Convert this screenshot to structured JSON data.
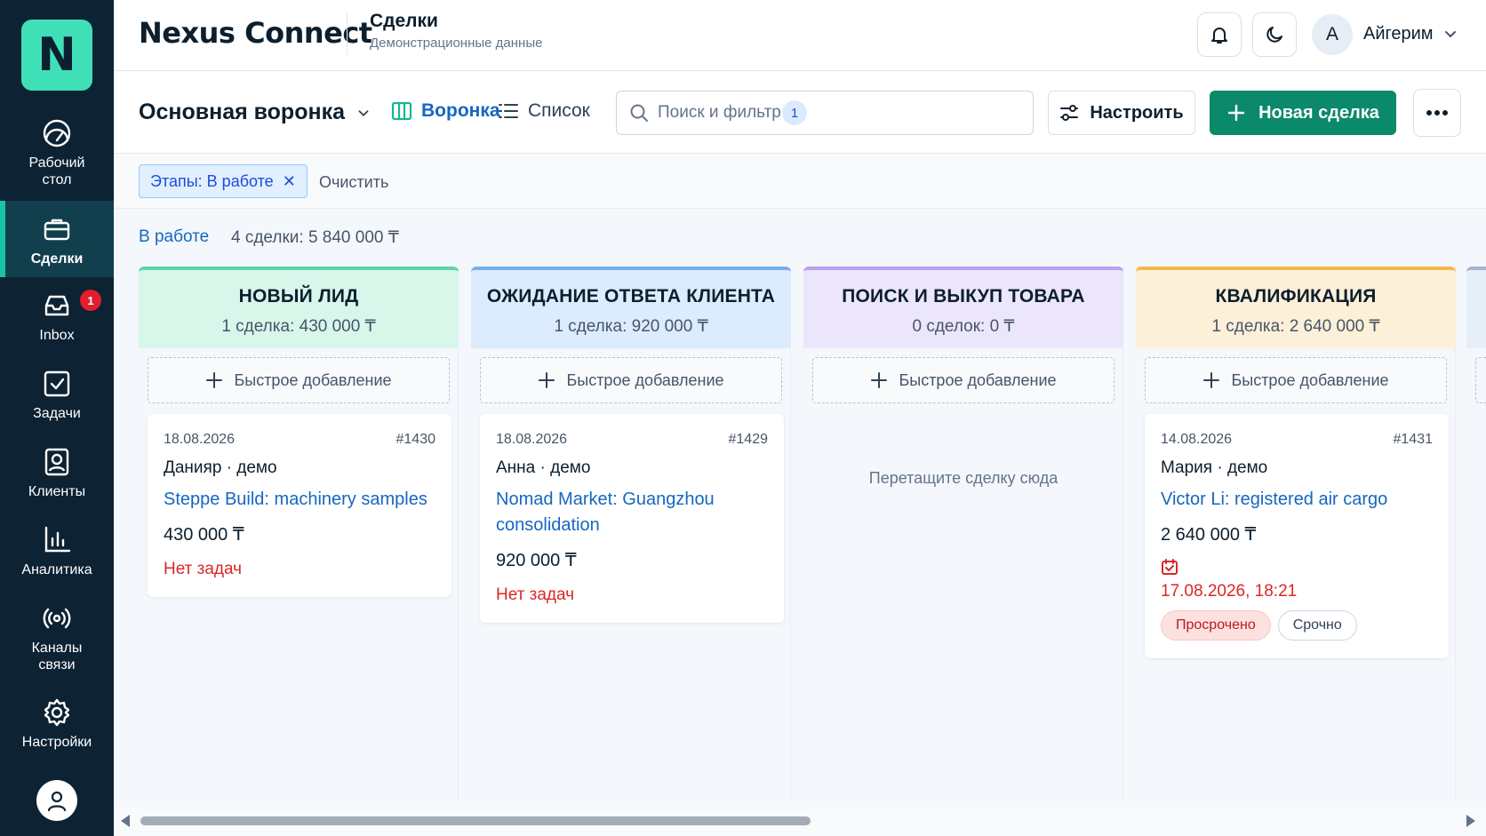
{
  "app": {
    "logo_letter": "N",
    "name": "Nexus Connect"
  },
  "sidebar": {
    "items": [
      {
        "label": "Рабочий стол",
        "icon": "dashboard-icon"
      },
      {
        "label": "Сделки",
        "icon": "briefcase-icon",
        "active": true
      },
      {
        "label": "Inbox",
        "icon": "inbox-icon",
        "badge": "1"
      },
      {
        "label": "Задачи",
        "icon": "task-check-icon"
      },
      {
        "label": "Клиенты",
        "icon": "contact-card-icon"
      },
      {
        "label": "Аналитика",
        "icon": "bar-chart-icon"
      },
      {
        "label": "Каналы связи",
        "icon": "broadcast-icon"
      },
      {
        "label": "Настройки",
        "icon": "gear-icon"
      }
    ],
    "profile_icon": "user-icon"
  },
  "header": {
    "title": "Сделки",
    "subtitle": "Демонстрационные данные",
    "user_initial": "А",
    "user_name": "Айгерим"
  },
  "toolbar": {
    "pipeline": "Основная воронка",
    "view_funnel": "Воронка",
    "view_list": "Список",
    "search_placeholder": "Поиск и фильтр",
    "filter_count": "1",
    "configure_label": "Настроить",
    "new_deal_label": "Новая сделка"
  },
  "filters": {
    "chip": "Этапы: В работе",
    "clear": "Очистить"
  },
  "summary": {
    "stage": "В работе",
    "total": "4 сделки: 5 840 000 ₸"
  },
  "quick_add_label": "Быстрое добавление",
  "columns": [
    {
      "title": "НОВЫЙ ЛИД",
      "subtitle": "1 сделка: 430 000 ₸",
      "color": "#5fd4a6",
      "bg": "#d8f6ea",
      "cards": [
        {
          "date": "18.08.2026",
          "id": "#1430",
          "person": "Данияр · демо",
          "title": "Steppe Build: machinery samples",
          "amount": "430 000 ₸",
          "tasks": "Нет задач"
        }
      ]
    },
    {
      "title": "ОЖИДАНИЕ ОТВЕТА КЛИЕНТА",
      "subtitle": "1 сделка: 920 000 ₸",
      "color": "#78aef0",
      "bg": "#dcebfd",
      "cards": [
        {
          "date": "18.08.2026",
          "id": "#1429",
          "person": "Анна · демо",
          "title": "Nomad Market: Guangzhou consolidation",
          "amount": "920 000 ₸",
          "tasks": "Нет задач"
        }
      ]
    },
    {
      "title": "ПОИСК И ВЫКУП ТОВАРА",
      "subtitle": "0 сделок: 0 ₸",
      "color": "#b9a2f0",
      "bg": "#ece6fc",
      "drop_hint": "Перетащите сделку сюда",
      "cards": []
    },
    {
      "title": "КВАЛИФИКАЦИЯ",
      "subtitle": "1 сделка: 2 640 000 ₸",
      "color": "#f5b84a",
      "bg": "#fdf0d8",
      "cards": [
        {
          "date": "14.08.2026",
          "id": "#1431",
          "person": "Мария · демо",
          "title": "Victor Li: registered air cargo",
          "amount": "2 640 000 ₸",
          "due": "17.08.2026, 18:21",
          "badges": [
            "Просрочено",
            "Срочно"
          ]
        }
      ]
    }
  ]
}
